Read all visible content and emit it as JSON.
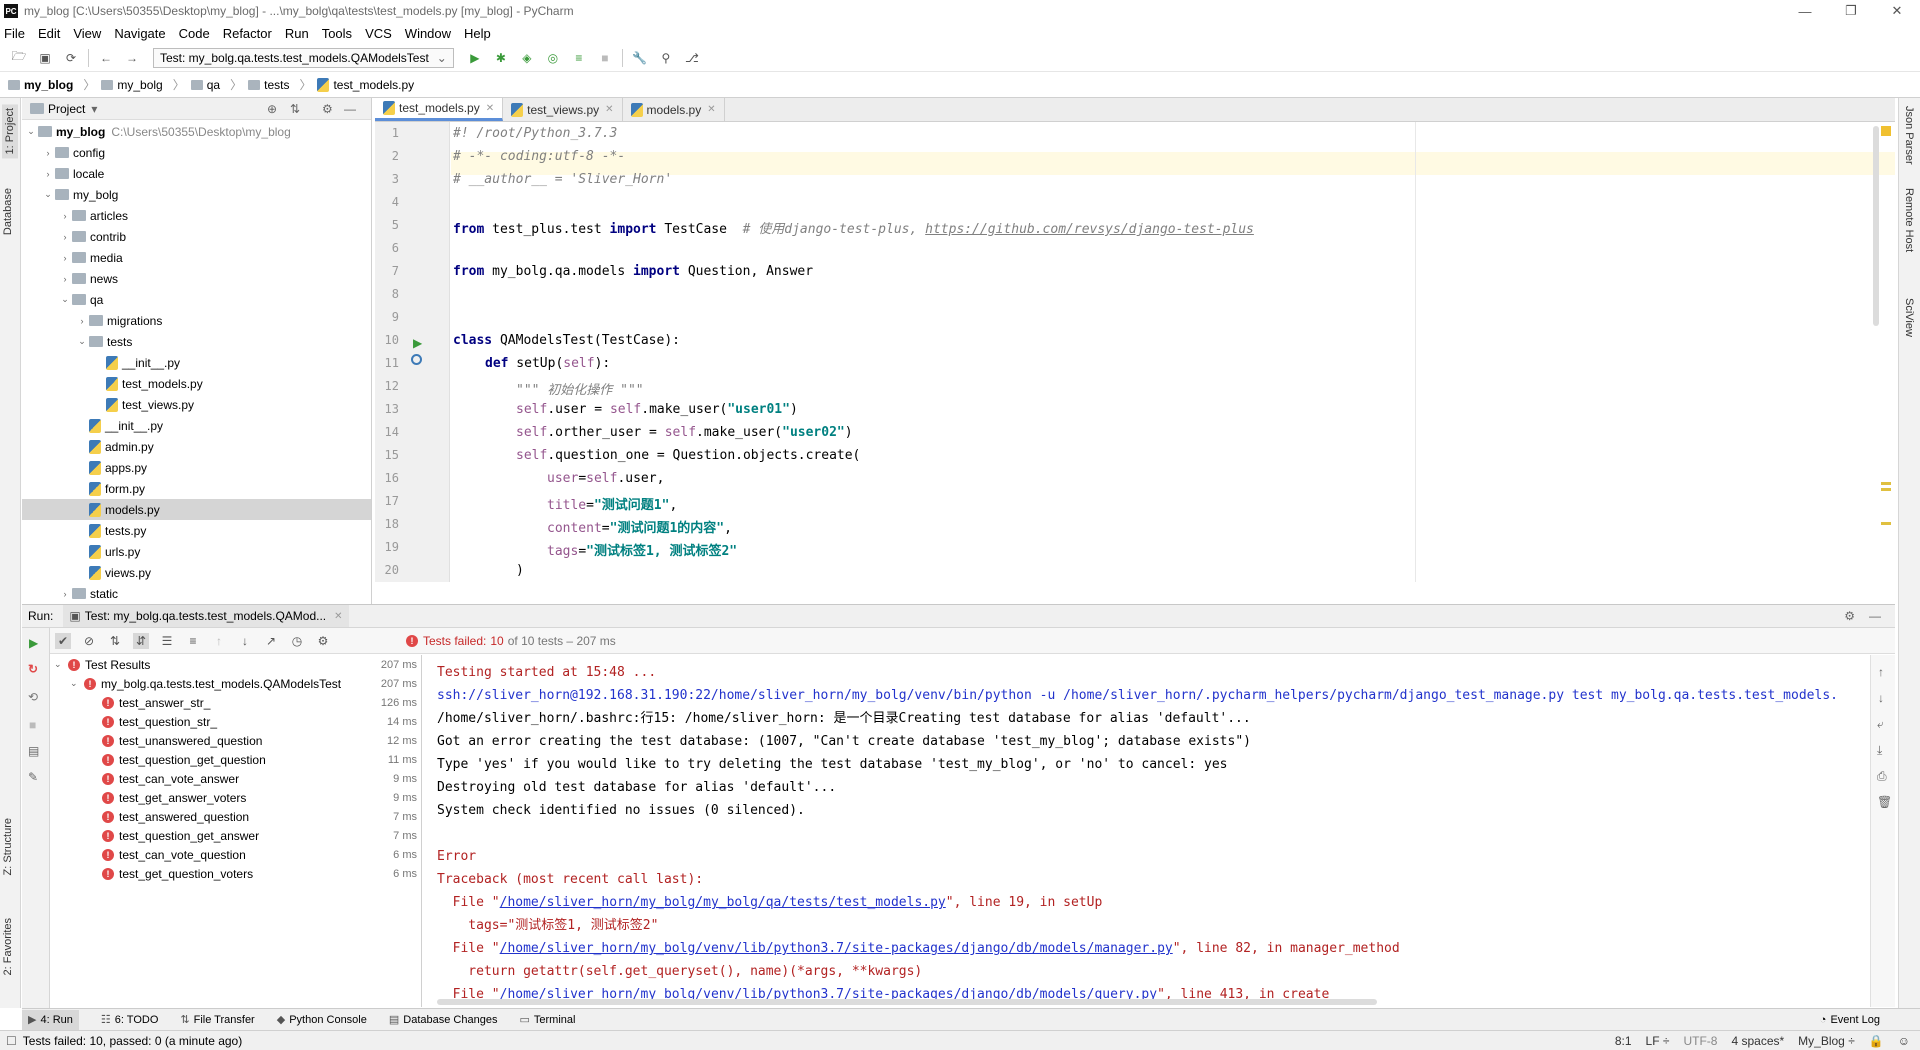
{
  "window": {
    "title": "my_blog [C:\\Users\\50355\\Desktop\\my_blog] - ...\\my_bolg\\qa\\tests\\test_models.py [my_blog] - PyCharm",
    "app_icon": "PC"
  },
  "menu": [
    "File",
    "Edit",
    "View",
    "Navigate",
    "Code",
    "Refactor",
    "Run",
    "Tools",
    "VCS",
    "Window",
    "Help"
  ],
  "toolbar": {
    "run_config": "Test: my_bolg.qa.tests.test_models.QAModelsTest"
  },
  "breadcrumb": [
    "my_blog",
    "my_bolg",
    "qa",
    "tests",
    "test_models.py"
  ],
  "left_strip": {
    "project": "1: Project",
    "database": "Database",
    "structure": "Z: Structure",
    "favorites": "2: Favorites"
  },
  "right_strip": {
    "json": "Json Parser",
    "remote": "Remote Host",
    "sciview": "SciView"
  },
  "project": {
    "header": "Project",
    "root_name": "my_blog",
    "root_path": "C:\\Users\\50355\\Desktop\\my_blog",
    "items": [
      {
        "label": "config",
        "level": 1,
        "kind": "folder",
        "arrow": "›"
      },
      {
        "label": "locale",
        "level": 1,
        "kind": "folder",
        "arrow": "›"
      },
      {
        "label": "my_bolg",
        "level": 1,
        "kind": "folder",
        "arrow": "⌄"
      },
      {
        "label": "articles",
        "level": 2,
        "kind": "folder",
        "arrow": "›"
      },
      {
        "label": "contrib",
        "level": 2,
        "kind": "folder",
        "arrow": "›"
      },
      {
        "label": "media",
        "level": 2,
        "kind": "folder",
        "arrow": "›"
      },
      {
        "label": "news",
        "level": 2,
        "kind": "folder",
        "arrow": "›"
      },
      {
        "label": "qa",
        "level": 2,
        "kind": "folder",
        "arrow": "⌄"
      },
      {
        "label": "migrations",
        "level": 3,
        "kind": "folder",
        "arrow": "›"
      },
      {
        "label": "tests",
        "level": 3,
        "kind": "folder",
        "arrow": "⌄"
      },
      {
        "label": "__init__.py",
        "level": 4,
        "kind": "py",
        "arrow": ""
      },
      {
        "label": "test_models.py",
        "level": 4,
        "kind": "py",
        "arrow": ""
      },
      {
        "label": "test_views.py",
        "level": 4,
        "kind": "py",
        "arrow": ""
      },
      {
        "label": "__init__.py",
        "level": 3,
        "kind": "py",
        "arrow": ""
      },
      {
        "label": "admin.py",
        "level": 3,
        "kind": "py",
        "arrow": ""
      },
      {
        "label": "apps.py",
        "level": 3,
        "kind": "py",
        "arrow": ""
      },
      {
        "label": "form.py",
        "level": 3,
        "kind": "py",
        "arrow": ""
      },
      {
        "label": "models.py",
        "level": 3,
        "kind": "py",
        "arrow": "",
        "selected": true
      },
      {
        "label": "tests.py",
        "level": 3,
        "kind": "py",
        "arrow": ""
      },
      {
        "label": "urls.py",
        "level": 3,
        "kind": "py",
        "arrow": ""
      },
      {
        "label": "views.py",
        "level": 3,
        "kind": "py",
        "arrow": ""
      },
      {
        "label": "static",
        "level": 2,
        "kind": "folder",
        "arrow": "›"
      }
    ]
  },
  "editor": {
    "tabs": [
      {
        "label": "test_models.py",
        "active": true
      },
      {
        "label": "test_views.py",
        "active": false
      },
      {
        "label": "models.py",
        "active": false
      }
    ],
    "line_numbers": [
      "1",
      "2",
      "3",
      "4",
      "5",
      "6",
      "7",
      "8",
      "9",
      "10",
      "11",
      "12",
      "13",
      "14",
      "15",
      "16",
      "17",
      "18",
      "19",
      "20"
    ]
  },
  "run": {
    "label": "Run:",
    "tab": "Test: my_bolg.qa.tests.test_models.QAMod...",
    "status_prefix": "Tests failed:",
    "status_count": "10",
    "status_suffix": "of 10 tests – 207 ms",
    "results_root": {
      "label": "Test Results",
      "ms": "207 ms"
    },
    "suite": {
      "label": "my_bolg.qa.tests.test_models.QAModelsTest",
      "ms": "207 ms"
    },
    "tests": [
      {
        "name": "test_answer_str_",
        "ms": "126 ms"
      },
      {
        "name": "test_question_str_",
        "ms": "14 ms"
      },
      {
        "name": "test_unanswered_question",
        "ms": "12 ms"
      },
      {
        "name": "test_question_get_question",
        "ms": "11 ms"
      },
      {
        "name": "test_can_vote_answer",
        "ms": "9 ms"
      },
      {
        "name": "test_get_answer_voters",
        "ms": "9 ms"
      },
      {
        "name": "test_answered_question",
        "ms": "7 ms"
      },
      {
        "name": "test_question_get_answer",
        "ms": "7 ms"
      },
      {
        "name": "test_can_vote_question",
        "ms": "6 ms"
      },
      {
        "name": "test_get_question_voters",
        "ms": "6 ms"
      }
    ],
    "console": [
      {
        "text": "Testing started at 15:48 ...",
        "style": "err"
      },
      {
        "text": "ssh://sliver_horn@192.168.31.190:22/home/sliver_horn/my_bolg/venv/bin/python -u /home/sliver_horn/.pycharm_helpers/pycharm/django_test_manage.py test my_bolg.qa.tests.test_models.",
        "style": "link"
      },
      {
        "text": "/home/sliver_horn/.bashrc:行15: /home/sliver_horn: 是一个目录Creating test database for alias 'default'...",
        "style": "plain"
      },
      {
        "text": "Got an error creating the test database: (1007, \"Can't create database 'test_my_blog'; database exists\")",
        "style": "plain"
      },
      {
        "text": "Type 'yes' if you would like to try deleting the test database 'test_my_blog', or 'no' to cancel: yes",
        "style": "plain"
      },
      {
        "text": "Destroying old test database for alias 'default'...",
        "style": "plain"
      },
      {
        "text": "System check identified no issues (0 silenced).",
        "style": "plain"
      },
      {
        "text": "",
        "style": "plain"
      },
      {
        "text": "Error",
        "style": "err"
      },
      {
        "text": "Traceback (most recent call last):",
        "style": "err"
      },
      {
        "pre": "  File \"",
        "link": "/home/sliver_horn/my_bolg/my_bolg/qa/tests/test_models.py",
        "post": "\", line 19, in setUp",
        "style": "trace"
      },
      {
        "text": "    tags=\"测试标签1, 测试标签2\"",
        "style": "err"
      },
      {
        "pre": "  File \"",
        "link": "/home/sliver_horn/my_bolg/venv/lib/python3.7/site-packages/django/db/models/manager.py",
        "post": "\", line 82, in manager_method",
        "style": "trace"
      },
      {
        "text": "    return getattr(self.get_queryset(), name)(*args, **kwargs)",
        "style": "err"
      },
      {
        "pre": "  File \"",
        "link": "/home/sliver_horn/my_bolg/venv/lib/python3.7/site-packages/django/db/models/query.py",
        "post": "\", line 413, in create",
        "style": "trace"
      }
    ]
  },
  "bottom_tabs": [
    {
      "label": "4: Run",
      "icon": "play-icon"
    },
    {
      "label": "6: TODO",
      "icon": "list-icon"
    },
    {
      "label": "File Transfer",
      "icon": "transfer-icon"
    },
    {
      "label": "Python Console",
      "icon": "python-icon"
    },
    {
      "label": "Database Changes",
      "icon": "database-icon"
    },
    {
      "label": "Terminal",
      "icon": "terminal-icon"
    }
  ],
  "event_log": "Event Log",
  "status": {
    "message": "Tests failed: 10, passed: 0 (a minute ago)",
    "position": "8:1",
    "line_sep": "LF ÷",
    "encoding": "UTF-8",
    "indent": "4 spaces*",
    "interpreter": "My_Blog ÷"
  },
  "code": {
    "l1": "#! /root/Python_3.7.3",
    "l2": "# -*- coding:utf-8 -*-",
    "l3": "# __author__ = 'Sliver_Horn'",
    "l5_from": "from",
    "l5_mod": " test_plus.test ",
    "l5_import": "import",
    "l5_name": " TestCase  ",
    "l5_comment": "# 使用django-test-plus, ",
    "l5_link": "https://github.com/revsys/django-test-plus",
    "l7_from": "from",
    "l7_mod": " my_bolg.qa.models ",
    "l7_import": "import",
    "l7_name": " Question, Answer",
    "l10_class": "class",
    "l10_rest": " QAModelsTest(TestCase):",
    "l11_def": "def",
    "l11_name": " setUp(",
    "l11_self": "self",
    "l11_end": "):",
    "l12": "\"\"\" 初始化操作 \"\"\"",
    "l13_self1": "self",
    "l13_mid": ".user = ",
    "l13_self2": "self",
    "l13_call": ".make_user(",
    "l13_str": "\"user01\"",
    "l13_end": ")",
    "l14_self1": "self",
    "l14_mid": ".orther_user = ",
    "l14_self2": "self",
    "l14_call": ".make_user(",
    "l14_str": "\"user02\"",
    "l14_end": ")",
    "l15_self": "self",
    "l15_rest": ".question_one = Question.objects.create(",
    "l16_kw": "user",
    "l16_eq": "=",
    "l16_self": "self",
    "l16_rest": ".user,",
    "l17_kw": "title",
    "l17_eq": "=",
    "l17_str": "\"测试问题1\"",
    "l17_end": ",",
    "l18_kw": "content",
    "l18_eq": "=",
    "l18_str": "\"测试问题1的内容\"",
    "l18_end": ",",
    "l19_kw": "tags",
    "l19_eq": "=",
    "l19_str": "\"测试标签1, 测试标签2\"",
    "l20": ")"
  }
}
